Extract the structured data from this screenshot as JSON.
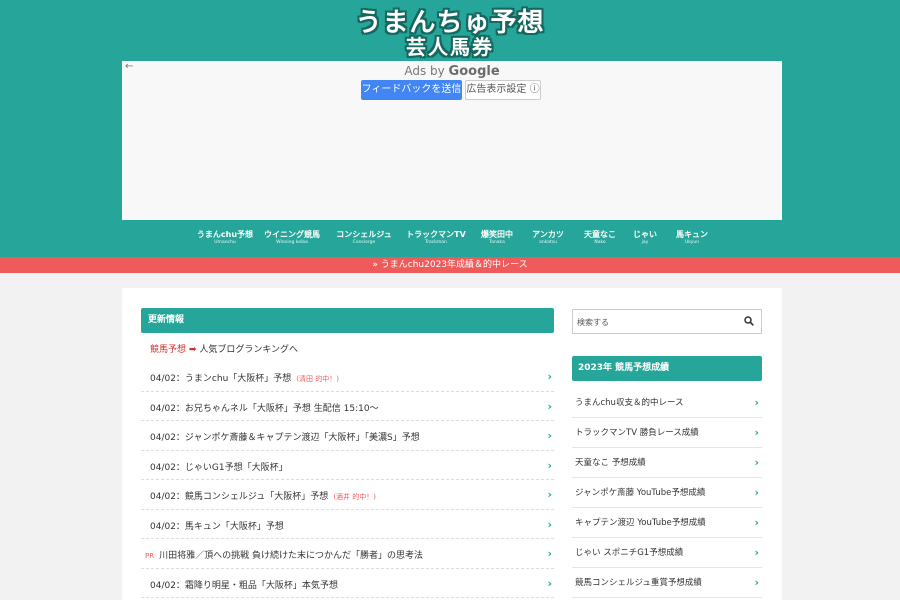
{
  "logo": {
    "line1": "うまんちゅ予想",
    "line2": "芸人馬券"
  },
  "ad": {
    "back": "←",
    "label_prefix": "Ads by ",
    "label_brand": "Google",
    "feedback_button": "フィードバックを送信",
    "settings_button": "広告表示設定 ⓘ"
  },
  "nav": [
    {
      "label": "うまんchu予想",
      "sub": "Umanchu"
    },
    {
      "label": "ウイニング競馬",
      "sub": "Winning keiba"
    },
    {
      "label": "コンシェルジュ",
      "sub": "Concierge"
    },
    {
      "label": "トラックマンTV",
      "sub": "Trackman"
    },
    {
      "label": "爆笑田中",
      "sub": "Tanaka"
    },
    {
      "label": "アンカツ",
      "sub": "ankatsu"
    },
    {
      "label": "天童なこ",
      "sub": "Nako"
    },
    {
      "label": "じゃい",
      "sub": "jay"
    },
    {
      "label": "馬キュン",
      "sub": "Ukyun"
    }
  ],
  "banner": "» うまんchu2023年成績＆的中レース",
  "main": {
    "section_title": "更新情報",
    "ranking": {
      "red": "競馬予想",
      "arrow": "➡",
      "text": "人気ブログランキングへ"
    },
    "updates": [
      {
        "pr": "",
        "text": "04/02：うまンchu「大阪杯」予想",
        "note": "(清田 的中！)"
      },
      {
        "pr": "",
        "text": "04/02：お兄ちゃんネル「大阪杯」予想 生配信 15:10〜",
        "note": ""
      },
      {
        "pr": "",
        "text": "04/02：ジャンポケ斎藤＆キャプテン渡辺「大阪杯」「美濃S」予想",
        "note": ""
      },
      {
        "pr": "",
        "text": "04/02：じゃいG1予想「大阪杯」",
        "note": ""
      },
      {
        "pr": "",
        "text": "04/02：競馬コンシェルジュ「大阪杯」予想",
        "note": "(酒井 的中！)"
      },
      {
        "pr": "",
        "text": "04/02：馬キュン「大阪杯」予想",
        "note": ""
      },
      {
        "pr": "PR",
        "text": "川田将雅／頂への挑戦 負け続けた末につかんだ「勝者」の思考法",
        "note": ""
      },
      {
        "pr": "",
        "text": "04/02：霜降り明星・粗品「大阪杯」本気予想",
        "note": ""
      }
    ]
  },
  "sidebar": {
    "search_placeholder": "検索する",
    "section_title": "2023年 競馬予想成績",
    "items": [
      "うまんchu収支＆的中レース",
      "トラックマンTV 勝負レース成績",
      "天童なこ 予想成績",
      "ジャンポケ斎藤 YouTube予想成績",
      "キャプテン渡辺 YouTube予想成績",
      "じゃい スポニチG1予想成績",
      "競馬コンシェルジュ重賞予想成績"
    ]
  },
  "colors": {
    "teal": "#26a69a",
    "banner": "#ef5b5b",
    "ad_button": "#4285f4"
  },
  "icons": {
    "chevron": "›",
    "search": "search-icon"
  }
}
